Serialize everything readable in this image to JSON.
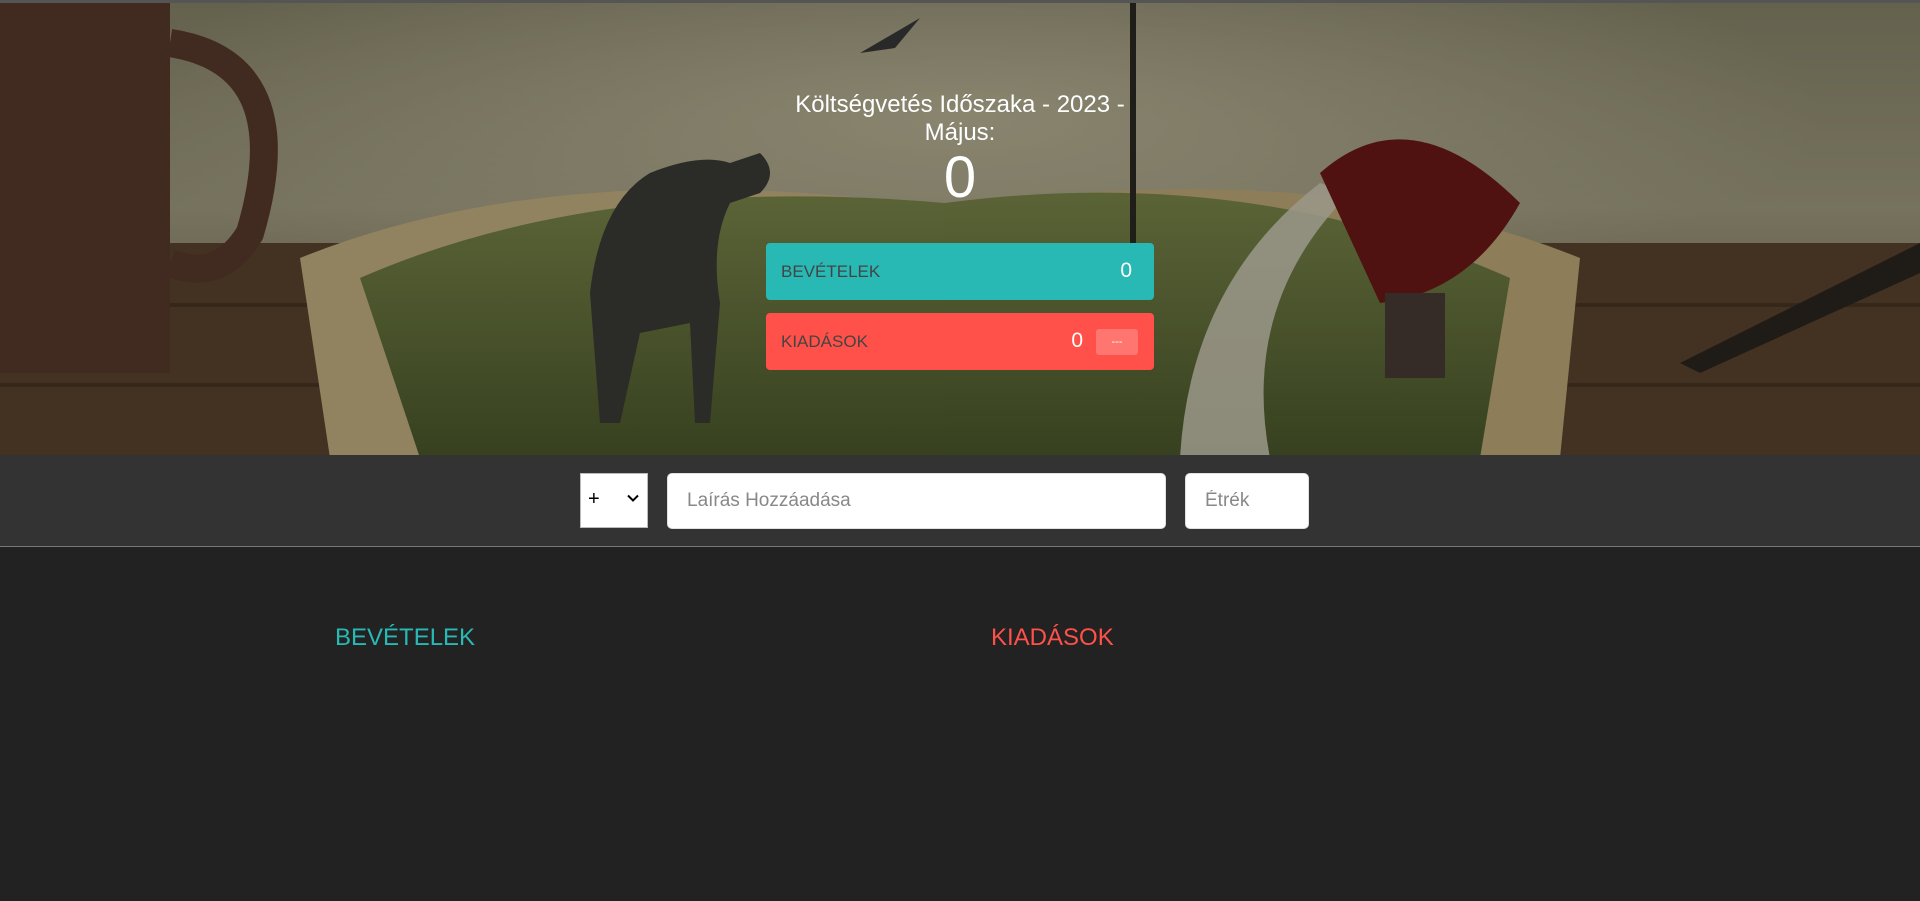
{
  "header": {
    "title": "Költségvetés Időszaka - 2023 - Május:",
    "budget_value": "0"
  },
  "summary": {
    "income_label": "BEVÉTELEK",
    "income_value": "0",
    "expense_label": "KIADÁSOK",
    "expense_value": "0",
    "expense_percentage": "---"
  },
  "add_form": {
    "type_selected": "+",
    "description_placeholder": "Laírás Hozzáadása",
    "value_placeholder": "Étrék"
  },
  "lists": {
    "income_title": "BEVÉTELEK",
    "expenses_title": "KIADÁSOK"
  },
  "colors": {
    "income": "#28b9b5",
    "expense": "#ff5049",
    "background": "#222222",
    "add_bar": "#333333"
  },
  "icons": {
    "select_arrow": "chevron-down-icon",
    "hero_image": "book-landscape-background"
  }
}
